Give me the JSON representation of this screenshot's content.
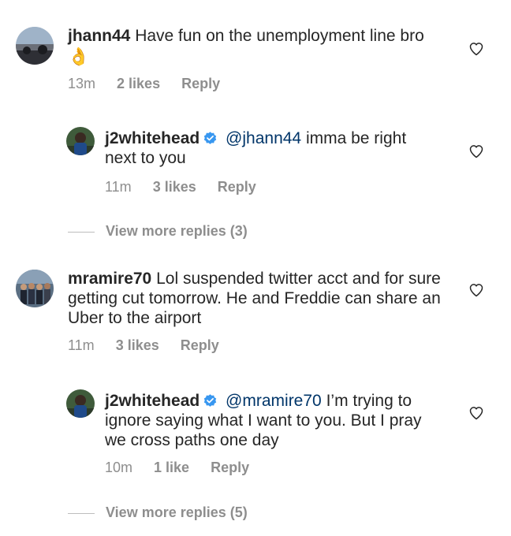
{
  "comments": [
    {
      "username": "jhann44",
      "text": "Have fun on the unemployment line bro",
      "emoji": "👌",
      "time": "13m",
      "likes": "2 likes",
      "reply": "Reply",
      "replies": [
        {
          "username": "j2whitehead",
          "verified": true,
          "mention": "@jhann44",
          "text": "imma be right next to you",
          "time": "11m",
          "likes": "3 likes",
          "reply": "Reply"
        }
      ],
      "view_more": "View more replies (3)"
    },
    {
      "username": "mramire70",
      "text": "Lol suspended twitter acct and for sure getting cut tomorrow. He and Freddie can share an Uber to the airport",
      "time": "11m",
      "likes": "3 likes",
      "reply": "Reply",
      "replies": [
        {
          "username": "j2whitehead",
          "verified": true,
          "mention": "@mramire70",
          "text": "I’m trying to ignore saying what I want to you. But I pray we cross paths one day",
          "time": "10m",
          "likes": "1 like",
          "reply": "Reply"
        }
      ],
      "view_more": "View more replies (5)"
    }
  ],
  "colors": {
    "text": "#262626",
    "meta": "#8e8e8e",
    "mention": "#003569",
    "verified": "#3897f0"
  },
  "icons": {
    "like": "heart-outline-icon",
    "verified": "verified-badge-icon"
  }
}
